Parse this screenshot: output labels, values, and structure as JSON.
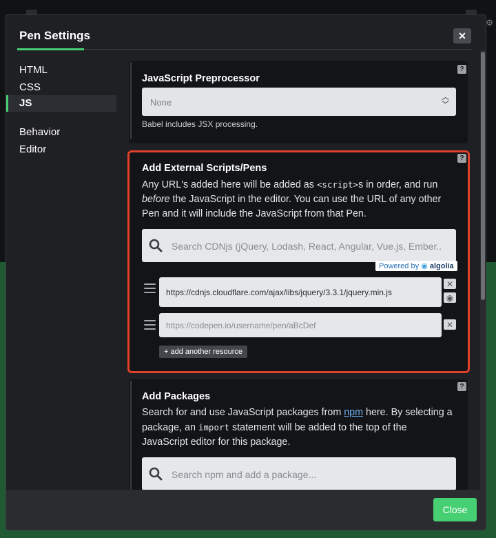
{
  "modal": {
    "title": "Pen Settings",
    "close_icon": "close-icon",
    "accent_color": "#47cf73"
  },
  "nav": {
    "items": [
      {
        "label": "HTML"
      },
      {
        "label": "CSS"
      },
      {
        "label": "JS",
        "active": true
      },
      {
        "label": "Behavior"
      },
      {
        "label": "Editor"
      }
    ]
  },
  "preprocessor": {
    "title": "JavaScript Preprocessor",
    "selected": "None",
    "note": "Babel includes JSX processing.",
    "help": "?"
  },
  "external": {
    "title": "Add External Scripts/Pens",
    "desc_pre": "Any URL's added here will be added as ",
    "desc_code": "<script>",
    "desc_mid": "s in order, and run ",
    "desc_em": "before",
    "desc_post": " the JavaScript in the editor. You can use the URL of any other Pen and it will include the JavaScript from that Pen.",
    "search_placeholder": "Search CDNjs (jQuery, Lodash, React, Angular, Vue.js, Ember..",
    "powered_by": "Powered by",
    "powered_brand": "algolia",
    "resources": [
      {
        "value": "https://cdnjs.cloudflare.com/ajax/libs/jquery/3.3.1/jquery.min.js",
        "placeholder": ""
      },
      {
        "value": "",
        "placeholder": "https://codepen.io/username/pen/aBcDef"
      }
    ],
    "add_label": "+ add another resource",
    "help": "?",
    "highlight_color": "#e0412b"
  },
  "packages": {
    "title": "Add Packages",
    "desc_pre": "Search for and use JavaScript packages from ",
    "desc_link": "npm",
    "desc_mid": " here. By selecting a package, an ",
    "desc_code": "import",
    "desc_post": " statement will be added to the top of the JavaScript editor for this package.",
    "search_placeholder": "Search npm and add a package...",
    "help": "?"
  },
  "footer": {
    "close_label": "Close"
  }
}
